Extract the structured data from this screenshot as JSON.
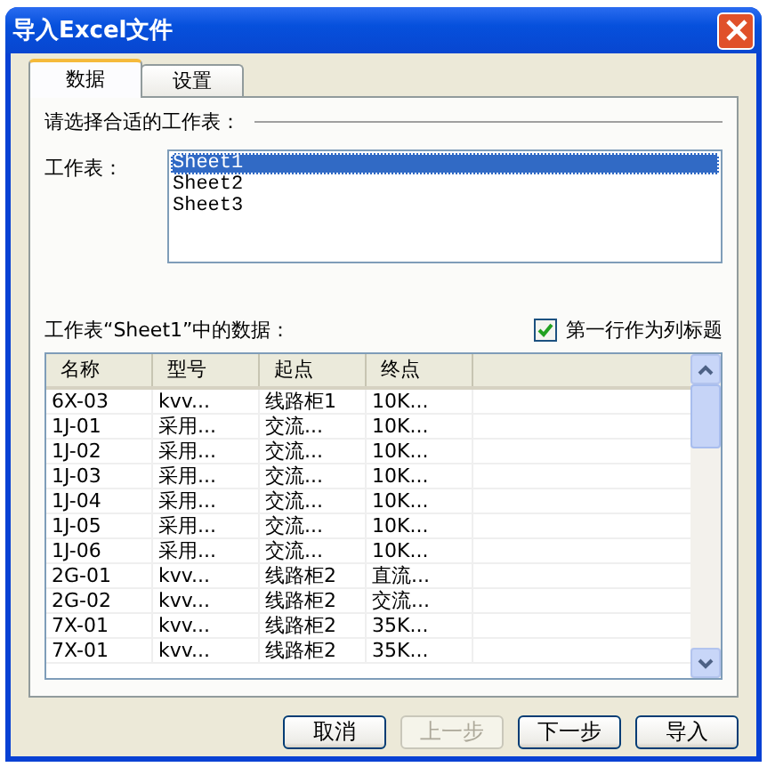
{
  "window": {
    "title": "导入Excel文件"
  },
  "tabs": [
    {
      "label": "数据",
      "selected": true
    },
    {
      "label": "设置",
      "selected": false
    }
  ],
  "section_label": "请选择合适的工作表：",
  "sheet_label": "工作表：",
  "sheets": [
    {
      "label": "Sheet1",
      "selected": true
    },
    {
      "label": "Sheet2",
      "selected": false
    },
    {
      "label": "Sheet3",
      "selected": false
    }
  ],
  "data_label": "工作表“Sheet1”中的数据：",
  "header_checkbox": {
    "label": "第一行作为列标题",
    "checked": true
  },
  "table": {
    "columns": [
      "名称",
      "型号",
      "起点",
      "终点"
    ],
    "rows": [
      [
        "6X-03",
        "kvv...",
        "线路柜1",
        "10K..."
      ],
      [
        "1J-01",
        "采用...",
        "交流...",
        "10K..."
      ],
      [
        "1J-02",
        "采用...",
        "交流...",
        "10K..."
      ],
      [
        "1J-03",
        "采用...",
        "交流...",
        "10K..."
      ],
      [
        "1J-04",
        "采用...",
        "交流...",
        "10K..."
      ],
      [
        "1J-05",
        "采用...",
        "交流...",
        "10K..."
      ],
      [
        "1J-06",
        "采用...",
        "交流...",
        "10K..."
      ],
      [
        "2G-01",
        "kvv...",
        "线路柜2",
        "直流..."
      ],
      [
        "2G-02",
        "kvv...",
        "线路柜2",
        "交流..."
      ],
      [
        "7X-01",
        "kvv...",
        "线路柜2",
        "35K..."
      ],
      [
        "7X-01",
        "kvv...",
        "线路柜2",
        "35K..."
      ]
    ]
  },
  "buttons": [
    {
      "label": "取消",
      "disabled": false
    },
    {
      "label": "上一步",
      "disabled": true
    },
    {
      "label": "下一步",
      "disabled": false
    },
    {
      "label": "导入",
      "disabled": false
    }
  ]
}
